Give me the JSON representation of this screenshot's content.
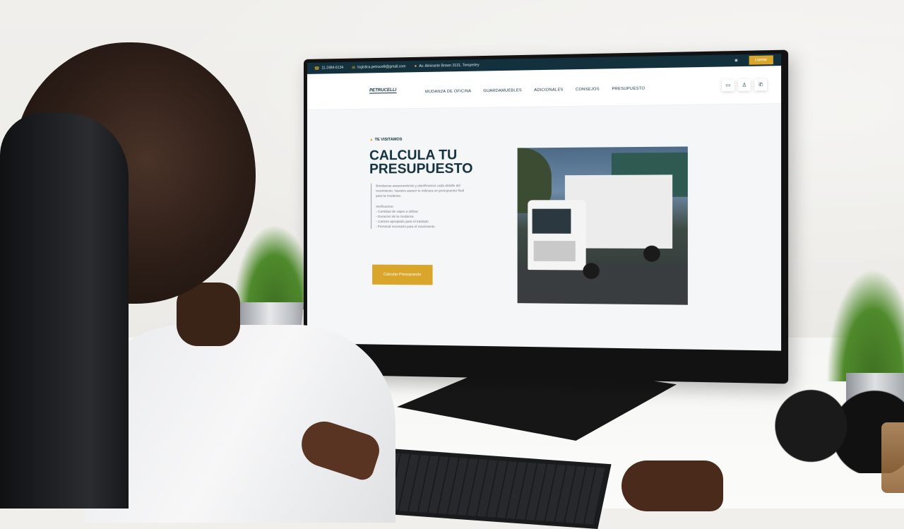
{
  "screen": {
    "topbar": {
      "phone": "11-2484-6134",
      "email": "logistica.petrucelli@gmail.com",
      "address": "Av. Almirante Brown 3131, Temperley",
      "call_button": "Llamar"
    },
    "navbar": {
      "logo_text": "PETRUCELLI",
      "items": [
        "MUDANZA DE OFICINA",
        "GUARDAMUEBLES",
        "ADICIONALES",
        "CONSEJOS",
        "PRESUPUESTO"
      ]
    },
    "hero": {
      "eyebrow": "TE VISITAMOS",
      "title": "CALCULA TU PRESUPUESTO",
      "paragraph": "Brindamos asesoramiento y planificamos cada detalle del movimiento. Nuestro asesor te indicara un presupuesto final para la mudanza.",
      "list_heading": "Verificamos:",
      "list_items": [
        "- Cantidad de viajes a utilizar",
        "- Duracion de la mudanza",
        "- Camion apropiado para el traslado",
        "- Personal necesario para el movimiento"
      ],
      "cta_label": "Calcular Presupuesto"
    }
  },
  "colors": {
    "topbar_bg": "#12313d",
    "accent": "#d9a52a",
    "heading": "#12313d"
  },
  "icons": [
    "phone-icon",
    "mail-icon",
    "location-icon",
    "whatsapp-icon",
    "chat-icon",
    "user-icon"
  ]
}
